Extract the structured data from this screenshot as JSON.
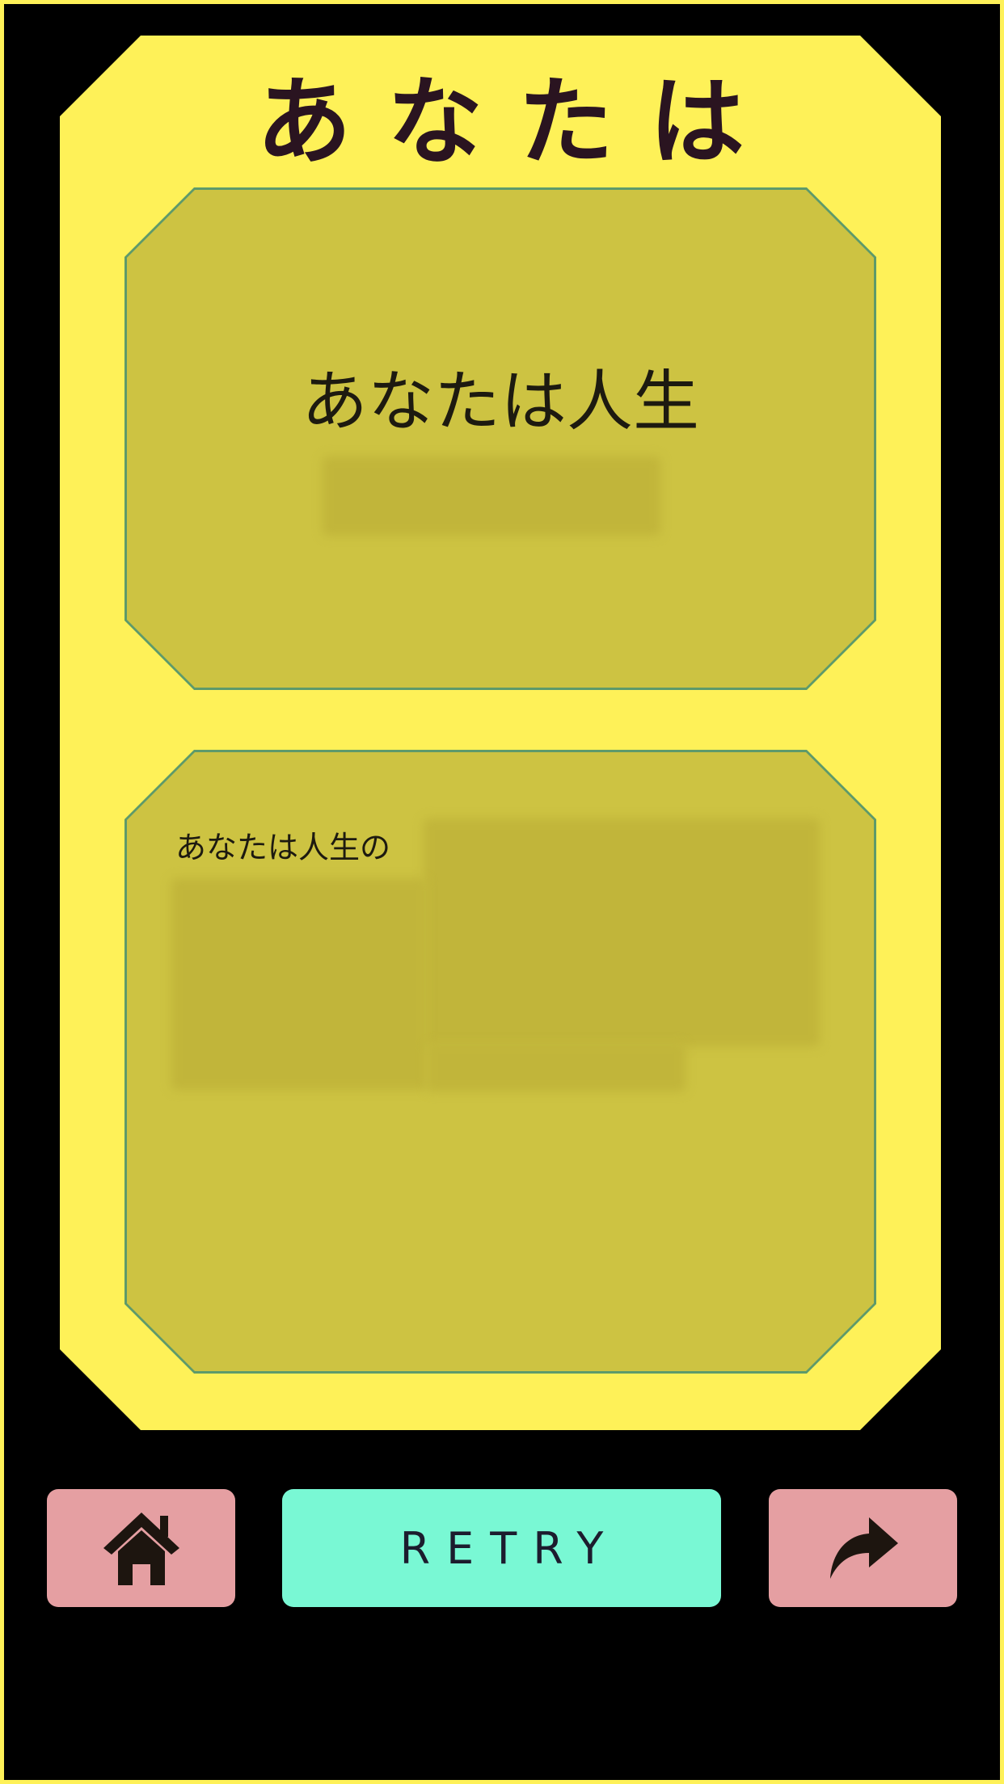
{
  "header": {
    "title": "あなたは"
  },
  "result": {
    "title": "あなたは人生"
  },
  "description": {
    "visible_text": "あなたは人生の"
  },
  "buttons": {
    "home_icon": "home-icon",
    "retry_label": "RETRY",
    "share_icon": "share-icon"
  },
  "colors": {
    "background": "#000000",
    "card": "#fef158",
    "panel": "#cdc342",
    "home_button": "#e59fa2",
    "retry_button": "#79f8d4",
    "share_button": "#e59fa2"
  }
}
